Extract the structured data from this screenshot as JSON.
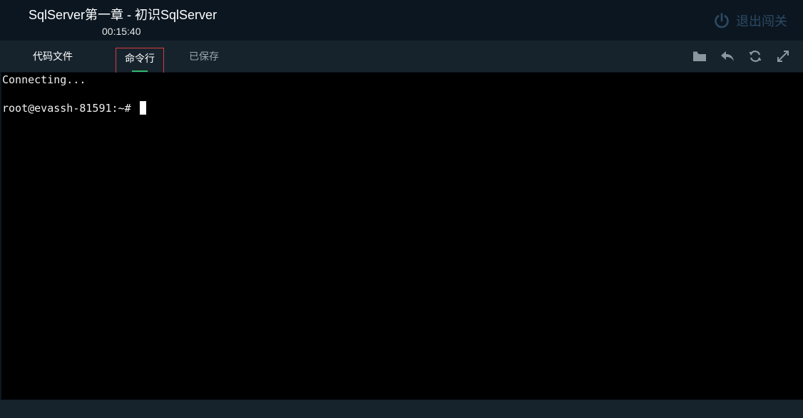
{
  "header": {
    "title": "SqlServer第一章 - 初识SqlServer",
    "timer": "00:15:40",
    "exit_label": "退出闯关",
    "exit_icon": "power-icon"
  },
  "tabs": [
    {
      "label": "代码文件",
      "active": false
    },
    {
      "label": "命令行",
      "active": true
    },
    {
      "label": "已保存",
      "active": false
    }
  ],
  "toolbar": {
    "icons": [
      "folder-icon",
      "undo-icon",
      "refresh-icon",
      "fullscreen-icon"
    ]
  },
  "terminal": {
    "line1": "Connecting...",
    "prompt": "root@evassh-81591:~# "
  },
  "colors": {
    "header_bg": "#0b1620",
    "tabbar_bg": "#16232d",
    "terminal_bg": "#000000",
    "active_tab_indicator": "#2fb96b",
    "highlight_border": "#d93a3a",
    "exit_button": "#2d4a63"
  }
}
